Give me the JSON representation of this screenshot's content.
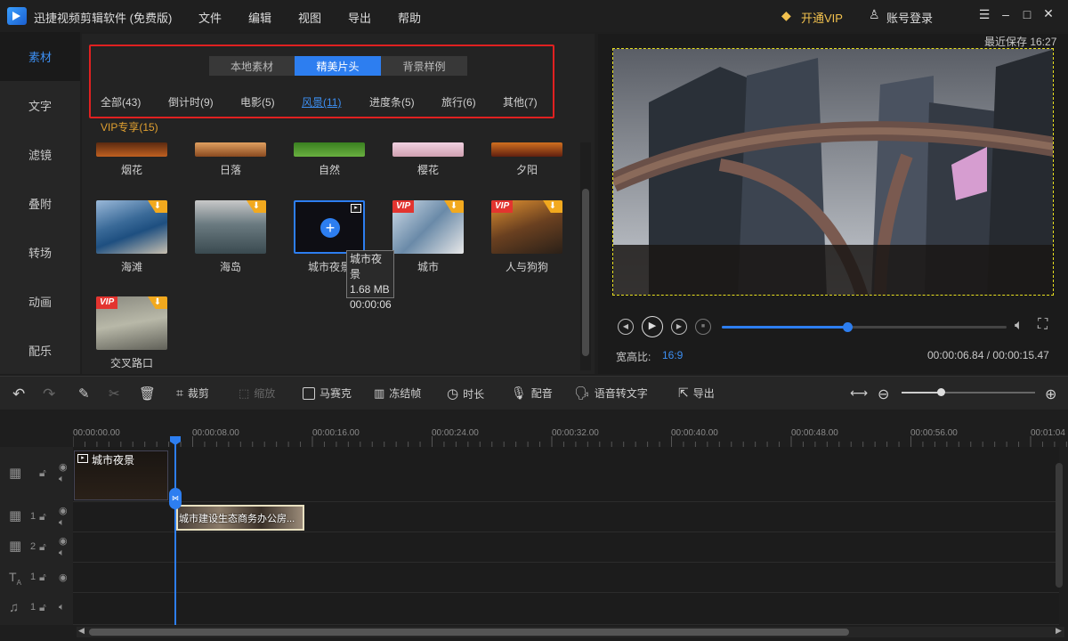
{
  "app": {
    "title": "迅捷视频剪辑软件 (免费版)"
  },
  "menu": [
    "文件",
    "编辑",
    "视图",
    "导出",
    "帮助"
  ],
  "topbar": {
    "vip_label": "开通VIP",
    "account_label": "账号登录"
  },
  "leftnav": {
    "items": [
      "素材",
      "文字",
      "滤镜",
      "叠附",
      "转场",
      "动画",
      "配乐"
    ]
  },
  "library": {
    "tabs": [
      "本地素材",
      "精美片头",
      "背景样例"
    ],
    "categories": [
      "全部(43)",
      "倒计时(9)",
      "电影(5)",
      "风景(11)",
      "进度条(5)",
      "旅行(6)",
      "其他(7)"
    ],
    "section_title": "VIP专享(15)",
    "row1": [
      "烟花",
      "日落",
      "自然",
      "樱花",
      "夕阳"
    ],
    "row2": [
      "海滩",
      "海岛",
      "城市夜景",
      "城市",
      "人与狗狗"
    ],
    "row3": [
      "交叉路口"
    ],
    "tooltip": {
      "name": "城市夜景",
      "size": "1.68 MB",
      "duration": "00:00:06"
    },
    "vip_badge": "VIP"
  },
  "preview": {
    "autosave": "最近保存 16:27",
    "aspect_label": "宽高比:",
    "aspect_value": "16:9",
    "time": "00:00:06.84 / 00:00:15.47",
    "progress": 0.44
  },
  "toolbar": {
    "crop": "裁剪",
    "zoom": "缩放",
    "mosaic": "马赛克",
    "freeze": "冻结帧",
    "duration": "时长",
    "dub": "配音",
    "tts": "语音转文字",
    "export": "导出"
  },
  "timeline": {
    "ticks": [
      "00:00:00.00",
      "00:00:08.00",
      "00:00:16.00",
      "00:00:24.00",
      "00:00:32.00",
      "00:00:40.00",
      "00:00:48.00",
      "00:00:56.00",
      "00:01:04"
    ],
    "clip1": "城市夜景",
    "clip2": "城市建设生态商务办公房...",
    "track_nums": [
      "1",
      "2",
      "1",
      "1"
    ]
  },
  "colors": {
    "accent": "#2d7ef0",
    "vip": "#e3342f",
    "highlight": "#e02020"
  }
}
